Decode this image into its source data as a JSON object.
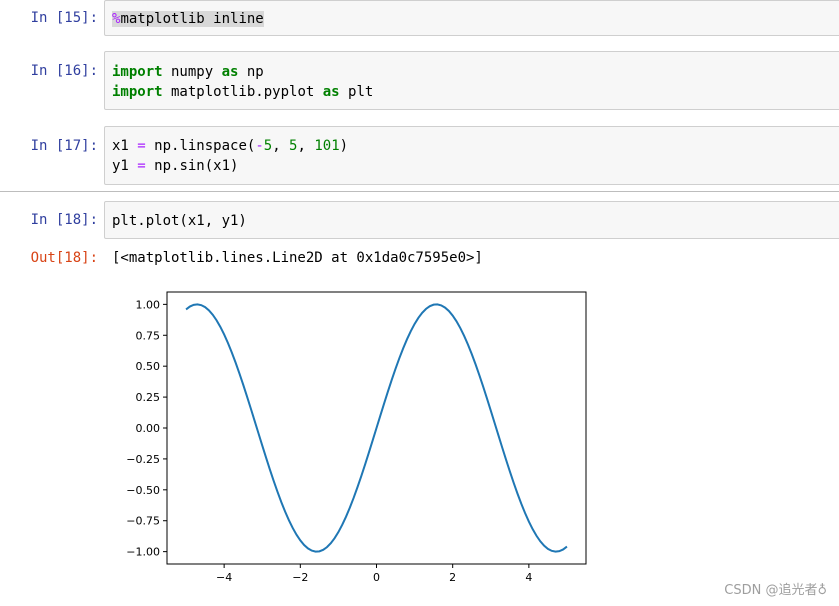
{
  "cells": [
    {
      "prompt": "In [15]:",
      "line": {
        "magic": "%",
        "magic_rest": "matplotlib inline"
      }
    },
    {
      "prompt": "In [16]:",
      "line1": {
        "kw1": "import",
        "mod": " numpy ",
        "kw2": "as",
        "alias": " np"
      },
      "line2": {
        "kw1": "import",
        "mod": " matplotlib.pyplot ",
        "kw2": "as",
        "alias": " plt"
      }
    },
    {
      "prompt": "In [17]:",
      "line1": {
        "a": "x1 ",
        "eq": "=",
        "b": " np.linspace(",
        "minus": "-",
        "n1": "5",
        "c1": ", ",
        "n2": "5",
        "c2": ", ",
        "n3": "101",
        "end": ")"
      },
      "line2": {
        "a": "y1 ",
        "eq": "=",
        "b": " np.sin(x1)"
      }
    },
    {
      "prompt": "In [18]:",
      "line": "plt.plot(x1, y1)"
    }
  ],
  "output": {
    "prompt": "Out[18]:",
    "text": "[<matplotlib.lines.Line2D at 0x1da0c7595e0>]"
  },
  "chart_data": {
    "type": "line",
    "function": "sin",
    "x_start": -5,
    "x_end": 5,
    "num_points": 101,
    "xlim": [
      -5.5,
      5.5
    ],
    "ylim": [
      -1.1,
      1.1
    ],
    "xticks": [
      -4,
      -2,
      0,
      2,
      4
    ],
    "xtick_labels": [
      "−4",
      "−2",
      "0",
      "2",
      "4"
    ],
    "yticks": [
      1.0,
      0.75,
      0.5,
      0.25,
      0.0,
      -0.25,
      -0.5,
      -0.75,
      -1.0
    ],
    "ytick_labels": [
      "1.00",
      "0.75",
      "0.50",
      "0.25",
      "0.00",
      "−0.25",
      "−0.50",
      "−0.75",
      "−1.00"
    ],
    "line_color": "#1f77b4",
    "grid": false
  },
  "watermark": "CSDN @追光者♁"
}
